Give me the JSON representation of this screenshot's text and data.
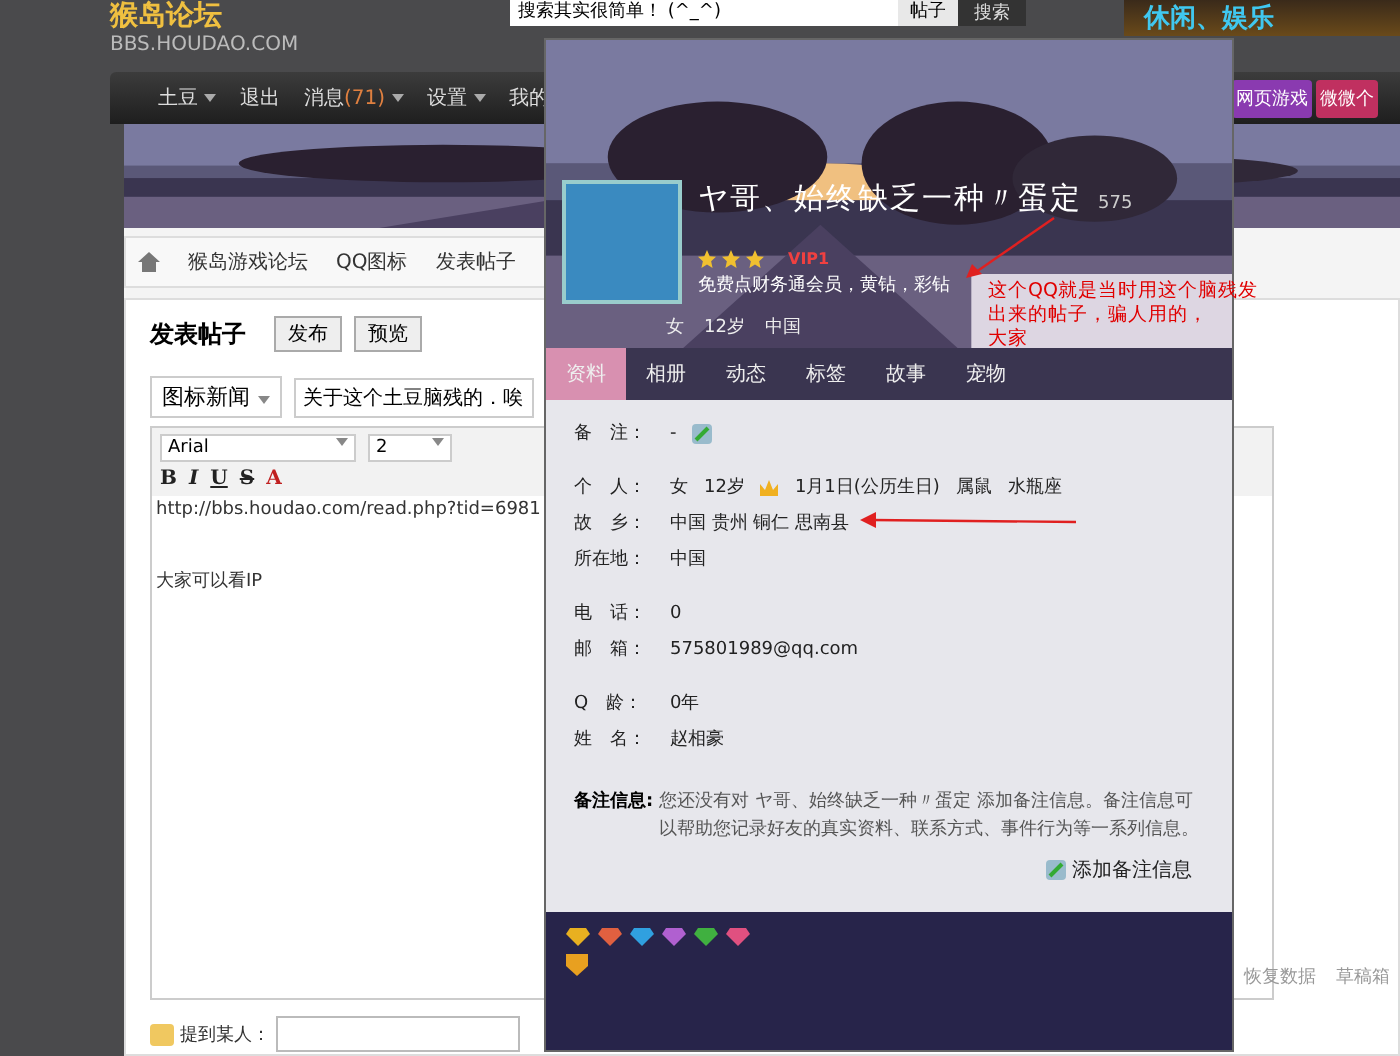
{
  "header": {
    "logo_title": "猴岛论坛",
    "logo_subtitle": "BBS.HOUDAO.COM",
    "search": {
      "value": "搜索其实很简单！ (^_^)"
    },
    "search_scope": "帖子",
    "search_button": "搜索",
    "banner_text": "休闲、娱乐"
  },
  "nav": {
    "items": [
      {
        "label": "土豆",
        "dropdown": true
      },
      {
        "label": "退出",
        "dropdown": false
      },
      {
        "label": "消息",
        "count": "(71)",
        "dropdown": true
      },
      {
        "label": "设置",
        "dropdown": true
      },
      {
        "label": "我的",
        "dropdown": false
      }
    ],
    "right_buttons": [
      "网页游戏",
      "微微个"
    ]
  },
  "breadcrumb": [
    "猴岛游戏论坛",
    "QQ图标",
    "发表帖子"
  ],
  "post": {
    "title": "发表帖子",
    "buttons": [
      "发布",
      "预览"
    ],
    "category": "图标新闻",
    "subject": "关于这个土豆脑残的．唉",
    "font": "Arial",
    "size": "2",
    "format_buttons": [
      "B",
      "I",
      "U",
      "S",
      "A"
    ],
    "body": [
      "http://bbs.houdao.com/read.php?tid=6981",
      "大家可以看IP"
    ],
    "mention_label": "提到某人：",
    "footer_links": [
      "恢复数据",
      "草稿箱"
    ]
  },
  "profile": {
    "name": "ヤ哥、始终缺乏一种〃蛋定",
    "level": "575",
    "stars": 3,
    "vip": "VIP1",
    "services": "免费点财务通会员，黄钻，彩钻",
    "basics": [
      "女",
      "12岁",
      "中国"
    ],
    "tabs": [
      {
        "label": "资料",
        "selected": true
      },
      {
        "label": "相册",
        "selected": false
      },
      {
        "label": "动态",
        "selected": false
      },
      {
        "label": "标签",
        "selected": false
      },
      {
        "label": "故事",
        "selected": false
      },
      {
        "label": "宠物",
        "selected": false
      }
    ],
    "field_groups": [
      [
        {
          "label": "备　注：",
          "values": [
            "-"
          ],
          "kind": "note"
        }
      ],
      [
        {
          "label": "个　人：",
          "values": [
            "女",
            "12岁",
            "1月1日(公历生日)",
            "属鼠",
            "水瓶座"
          ],
          "kind": "personal"
        },
        {
          "label": "故　乡：",
          "values": [
            "中国 贵州 铜仁 思南县"
          ],
          "kind": "text"
        },
        {
          "label": "所在地：",
          "values": [
            "中国"
          ],
          "kind": "text"
        }
      ],
      [
        {
          "label": "电　话：",
          "values": [
            "0"
          ],
          "kind": "text"
        },
        {
          "label": "邮　箱：",
          "values": [
            "575801989@qq.com"
          ],
          "kind": "text"
        }
      ],
      [
        {
          "label": "Q　龄：",
          "values": [
            "0年"
          ],
          "kind": "text"
        },
        {
          "label": "姓　名：",
          "values": [
            "赵相豪"
          ],
          "kind": "text"
        }
      ]
    ],
    "note_label": "备注信息:",
    "note_text": "您还没有对 ヤ哥、始终缺乏一种〃蛋定 添加备注信息。备注信息可以帮助您记录好友的真实资料、联系方式、事件行为等一系列信息。",
    "add_note": "添加备注信息",
    "gems": [
      {
        "color": "#e8b020"
      },
      {
        "color": "#e06040"
      },
      {
        "color": "#30a0e0"
      },
      {
        "color": "#b060d0"
      },
      {
        "color": "#40b040"
      },
      {
        "color": "#e05080"
      }
    ]
  },
  "annotation": {
    "lines": [
      "这个QQ就是当时用这个脑残发",
      "出来的帖子，骗人用的，",
      "大家"
    ]
  }
}
